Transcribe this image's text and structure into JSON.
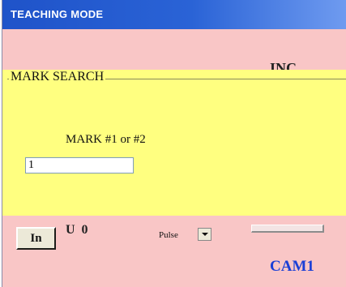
{
  "window": {
    "title": "TEACHING MODE"
  },
  "background_text": {
    "inc": "INC",
    "u0": "U 0"
  },
  "mark_search": {
    "legend": "MARK SEARCH",
    "label": "MARK #1 or #2",
    "value": "1"
  },
  "controls": {
    "in_button": "In",
    "pulse_label": "Pulse",
    "camera_label": "CAM1"
  },
  "colors": {
    "title_bar": "#1f53c9",
    "window_background": "#f9c6c6",
    "panel_background": "#ffff80",
    "camera_text": "#1a3fd6"
  },
  "icons": {
    "dropdown": "chevron-down-icon"
  }
}
